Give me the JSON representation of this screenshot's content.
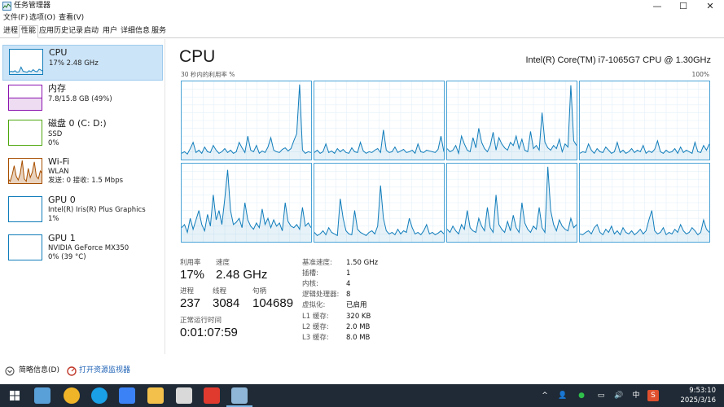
{
  "window": {
    "title": "任务管理器",
    "icon": "task-manager-icon",
    "controls": {
      "minimize": "—",
      "maximize": "☐",
      "close": "✕"
    }
  },
  "menu": [
    "文件(F)",
    "选项(O)",
    "查看(V)"
  ],
  "tabs": [
    {
      "label": "进程",
      "active": false
    },
    {
      "label": "性能",
      "active": true
    },
    {
      "label": "应用历史记录",
      "active": false
    },
    {
      "label": "启动",
      "active": false
    },
    {
      "label": "用户",
      "active": false
    },
    {
      "label": "详细信息",
      "active": false
    },
    {
      "label": "服务",
      "active": false
    }
  ],
  "sidebar": [
    {
      "name": "CPU",
      "lines": [
        "17% 2.48 GHz"
      ],
      "color": "#117dbb",
      "selected": true
    },
    {
      "name": "内存",
      "lines": [
        "7.8/15.8 GB (49%)"
      ],
      "color": "#8b12ae",
      "selected": false
    },
    {
      "name": "磁盘 0 (C: D:)",
      "lines": [
        "SSD",
        "0%"
      ],
      "color": "#4da60c",
      "selected": false
    },
    {
      "name": "Wi-Fi",
      "lines": [
        "WLAN",
        "发送: 0 接收: 1.5 Mbps"
      ],
      "color": "#a74f01",
      "selected": false
    },
    {
      "name": "GPU 0",
      "lines": [
        "Intel(R) Iris(R) Plus Graphics",
        "1%"
      ],
      "color": "#117dbb",
      "selected": false
    },
    {
      "name": "GPU 1",
      "lines": [
        "NVIDIA GeForce MX350",
        "0% (39 °C)"
      ],
      "color": "#117dbb",
      "selected": false
    }
  ],
  "main": {
    "title": "CPU",
    "model": "Intel(R) Core(TM) i7-1065G7 CPU @ 1.30GHz",
    "graph_label": "30 秒内的利用率 %",
    "graph_max": "100%",
    "stats": {
      "utilization_label": "利用率",
      "utilization": "17%",
      "speed_label": "速度",
      "speed": "2.48 GHz",
      "processes_label": "进程",
      "processes": "237",
      "threads_label": "线程",
      "threads": "3084",
      "handles_label": "句柄",
      "handles": "104689",
      "uptime_label": "正常运行时间",
      "uptime": "0:01:07:59"
    },
    "specs": [
      {
        "k": "基准速度:",
        "v": "1.50 GHz"
      },
      {
        "k": "插槽:",
        "v": "1"
      },
      {
        "k": "内核:",
        "v": "4"
      },
      {
        "k": "逻辑处理器:",
        "v": "8"
      },
      {
        "k": "虚拟化:",
        "v": "已启用"
      },
      {
        "k": "L1 缓存:",
        "v": "320 KB"
      },
      {
        "k": "L2 缓存:",
        "v": "2.0 MB"
      },
      {
        "k": "L3 缓存:",
        "v": "8.0 MB"
      }
    ]
  },
  "footer": {
    "brief": "简略信息(D)",
    "monitor": "打开资源监视器"
  },
  "taskbar": {
    "apps": [
      {
        "name": "start-icon",
        "color": "#ffffff"
      },
      {
        "name": "files-app-icon",
        "color": "#5aa0d8"
      },
      {
        "name": "night-app-icon",
        "color": "#f0b429"
      },
      {
        "name": "edge-icon",
        "color": "#1aa0e6"
      },
      {
        "name": "chat-app-icon",
        "color": "#3b82f6"
      },
      {
        "name": "folder-icon",
        "color": "#f3c14b"
      },
      {
        "name": "avatar-app-icon",
        "color": "#d9d9d9"
      },
      {
        "name": "wps-icon",
        "color": "#e03a2f"
      },
      {
        "name": "task-manager-icon",
        "color": "#8fb6d6"
      }
    ],
    "tray": [
      "^",
      "👤",
      "●",
      "▭",
      "🔊",
      "中",
      "S"
    ],
    "time": "9:53:10",
    "date": "2025/3/16"
  },
  "cpu_cores": [
    [
      8,
      10,
      7,
      14,
      22,
      9,
      12,
      8,
      16,
      10,
      9,
      18,
      12,
      8,
      10,
      14,
      9,
      12,
      8,
      10,
      22,
      15,
      9,
      30,
      12,
      10,
      18,
      8,
      11,
      9,
      16,
      28,
      12,
      10,
      9,
      13,
      15,
      11,
      14,
      24,
      33,
      96,
      12,
      8,
      10,
      9
    ],
    [
      9,
      12,
      8,
      10,
      20,
      9,
      11,
      8,
      14,
      10,
      13,
      9,
      8,
      15,
      10,
      9,
      22,
      11,
      8,
      10,
      9,
      12,
      14,
      9,
      38,
      12,
      9,
      10,
      16,
      9,
      11,
      13,
      9,
      10,
      12,
      8,
      20,
      10,
      9,
      12,
      11,
      10,
      9,
      13,
      30,
      10
    ],
    [
      14,
      10,
      12,
      18,
      8,
      30,
      20,
      12,
      10,
      28,
      15,
      40,
      22,
      14,
      10,
      18,
      35,
      12,
      28,
      20,
      15,
      12,
      22,
      18,
      30,
      14,
      26,
      12,
      10,
      36,
      14,
      18,
      12,
      60,
      22,
      15,
      12,
      18,
      14,
      26,
      10,
      20,
      16,
      95,
      24,
      18
    ],
    [
      8,
      10,
      9,
      20,
      12,
      8,
      14,
      10,
      9,
      16,
      12,
      8,
      10,
      22,
      9,
      12,
      8,
      10,
      14,
      9,
      12,
      10,
      18,
      8,
      11,
      9,
      13,
      24,
      10,
      8,
      12,
      9,
      10,
      14,
      8,
      16,
      9,
      12,
      10,
      8,
      22,
      10,
      9,
      18,
      12,
      20
    ],
    [
      18,
      22,
      12,
      30,
      16,
      28,
      40,
      22,
      14,
      35,
      20,
      60,
      28,
      40,
      22,
      55,
      92,
      40,
      22,
      25,
      30,
      18,
      50,
      28,
      20,
      16,
      24,
      18,
      42,
      22,
      30,
      18,
      28,
      20,
      24,
      14,
      50,
      26,
      20,
      18,
      22,
      16,
      44,
      20,
      24,
      18
    ],
    [
      12,
      8,
      10,
      14,
      9,
      18,
      12,
      10,
      8,
      55,
      30,
      14,
      10,
      9,
      40,
      16,
      12,
      10,
      8,
      12,
      14,
      10,
      20,
      72,
      30,
      14,
      10,
      12,
      9,
      16,
      10,
      14,
      12,
      30,
      18,
      10,
      12,
      9,
      14,
      22,
      10,
      12,
      9,
      11,
      14,
      10
    ],
    [
      16,
      12,
      20,
      14,
      10,
      22,
      16,
      40,
      18,
      14,
      12,
      30,
      20,
      14,
      44,
      18,
      12,
      60,
      22,
      16,
      12,
      26,
      14,
      34,
      18,
      12,
      50,
      24,
      16,
      12,
      20,
      16,
      44,
      18,
      12,
      96,
      40,
      22,
      14,
      28,
      20,
      16,
      14,
      30,
      18,
      22
    ],
    [
      10,
      9,
      12,
      14,
      10,
      18,
      22,
      12,
      9,
      16,
      12,
      20,
      10,
      14,
      9,
      18,
      12,
      10,
      14,
      9,
      12,
      16,
      10,
      14,
      28,
      40,
      14,
      10,
      12,
      18,
      9,
      12,
      10,
      16,
      12,
      22,
      14,
      10,
      12,
      18,
      14,
      9,
      12,
      28,
      16,
      12
    ]
  ],
  "sidebar_graphs": {
    "cpu": [
      10,
      14,
      12,
      16,
      10,
      12,
      30,
      14,
      12,
      10,
      16,
      12,
      20,
      14,
      12,
      22,
      18,
      14
    ],
    "memory": [
      49,
      49,
      49,
      49,
      49,
      49,
      49,
      49,
      49,
      49,
      49,
      49,
      49,
      49,
      49,
      49,
      49,
      49
    ],
    "disk": [
      0,
      0,
      0,
      0,
      0,
      0,
      0,
      0,
      0,
      0,
      0,
      0,
      0,
      0,
      0,
      0,
      0,
      0
    ],
    "wifi": [
      20,
      10,
      35,
      70,
      30,
      15,
      40,
      90,
      20,
      10,
      60,
      25,
      45,
      85,
      30,
      20,
      50,
      40
    ],
    "gpu0": [
      1,
      1,
      1,
      1,
      1,
      1,
      1,
      1,
      1,
      1,
      1,
      1,
      1,
      1,
      1,
      1,
      1,
      1
    ],
    "gpu1": [
      0,
      0,
      0,
      0,
      0,
      0,
      0,
      0,
      0,
      0,
      0,
      0,
      0,
      0,
      0,
      0,
      0,
      0
    ]
  }
}
